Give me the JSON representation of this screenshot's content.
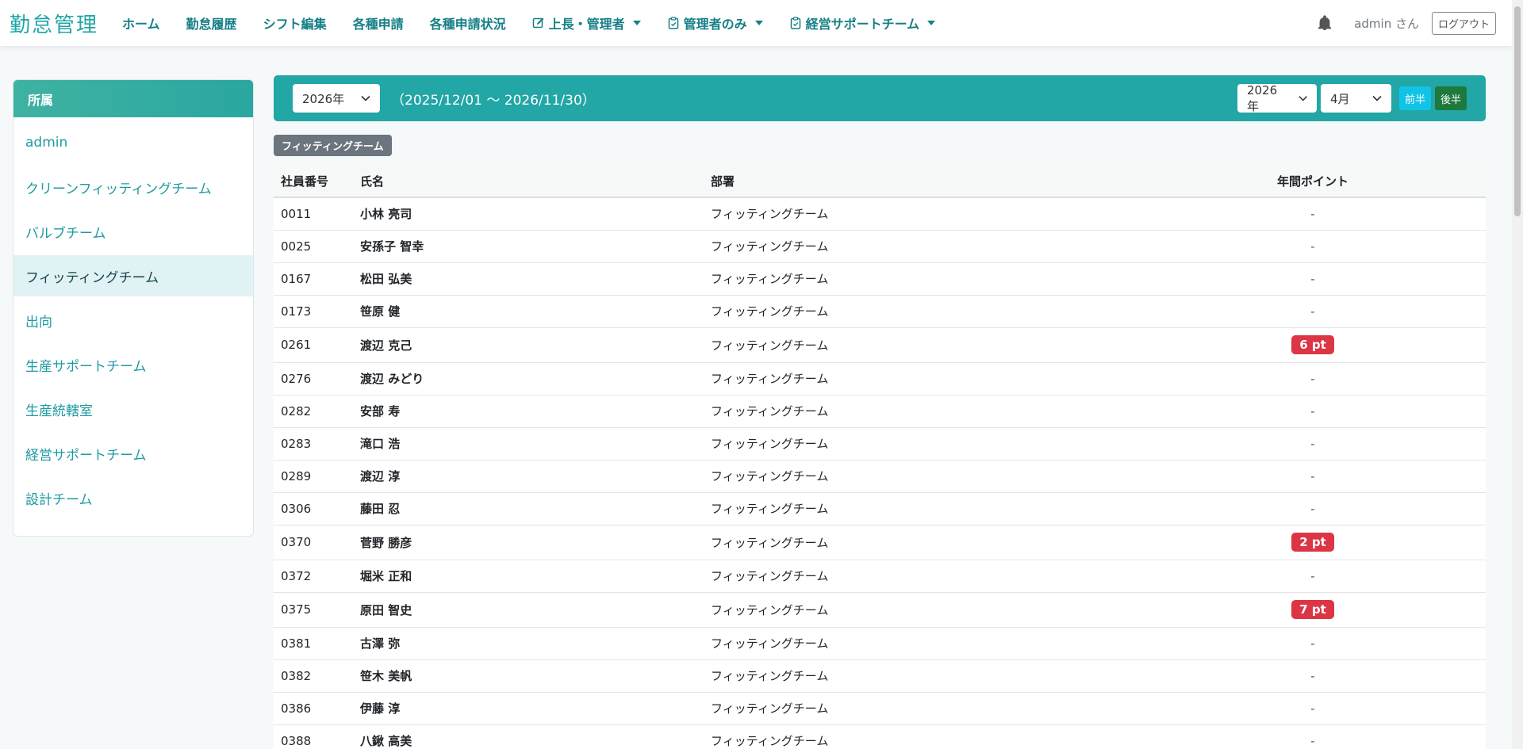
{
  "navbar": {
    "brand": "勤怠管理",
    "items": [
      {
        "label": "ホーム"
      },
      {
        "label": "勤怠履歴"
      },
      {
        "label": "シフト編集"
      },
      {
        "label": "各種申請"
      },
      {
        "label": "各種申請状況"
      },
      {
        "label": "上長・管理者",
        "icon": "edit-icon"
      },
      {
        "label": "管理者のみ",
        "icon": "clipboard-icon"
      },
      {
        "label": "経営サポートチーム",
        "icon": "clipboard-icon"
      }
    ],
    "user": "admin さん",
    "logout": "ログアウト"
  },
  "sidebar": {
    "title": "所属",
    "items": [
      {
        "label": "admin"
      },
      {
        "label": "クリーンフィッティングチーム"
      },
      {
        "label": "バルブチーム"
      },
      {
        "label": "フィッティングチーム",
        "active": true
      },
      {
        "label": "出向"
      },
      {
        "label": "生産サポートチーム"
      },
      {
        "label": "生産統轄室"
      },
      {
        "label": "経営サポートチーム"
      },
      {
        "label": "設計チーム"
      }
    ]
  },
  "filter": {
    "fiscal_year": "2026年",
    "range": "（2025/12/01 〜 2026/11/30）",
    "year": "2026年",
    "month": "4月",
    "first_half": "前半",
    "second_half": "後半"
  },
  "team_badge": "フィッティングチーム",
  "table": {
    "headers": {
      "id": "社員番号",
      "name": "氏名",
      "dept": "部署",
      "points": "年間ポイント"
    },
    "rows": [
      {
        "id": "0011",
        "name": "小林 亮司",
        "dept": "フィッティングチーム",
        "points": "-"
      },
      {
        "id": "0025",
        "name": "安孫子 智幸",
        "dept": "フィッティングチーム",
        "points": "-"
      },
      {
        "id": "0167",
        "name": "松田 弘美",
        "dept": "フィッティングチーム",
        "points": "-"
      },
      {
        "id": "0173",
        "name": "笹原 健",
        "dept": "フィッティングチーム",
        "points": "-"
      },
      {
        "id": "0261",
        "name": "渡辺 克己",
        "dept": "フィッティングチーム",
        "points": "6 pt",
        "highlight": true
      },
      {
        "id": "0276",
        "name": "渡辺 みどり",
        "dept": "フィッティングチーム",
        "points": "-"
      },
      {
        "id": "0282",
        "name": "安部 寿",
        "dept": "フィッティングチーム",
        "points": "-"
      },
      {
        "id": "0283",
        "name": "滝口 浩",
        "dept": "フィッティングチーム",
        "points": "-"
      },
      {
        "id": "0289",
        "name": "渡辺 淳",
        "dept": "フィッティングチーム",
        "points": "-"
      },
      {
        "id": "0306",
        "name": "藤田 忍",
        "dept": "フィッティングチーム",
        "points": "-"
      },
      {
        "id": "0370",
        "name": "菅野 勝彦",
        "dept": "フィッティングチーム",
        "points": "2 pt",
        "highlight": true
      },
      {
        "id": "0372",
        "name": "堀米 正和",
        "dept": "フィッティングチーム",
        "points": "-"
      },
      {
        "id": "0375",
        "name": "原田 智史",
        "dept": "フィッティングチーム",
        "points": "7 pt",
        "highlight": true
      },
      {
        "id": "0381",
        "name": "古澤 弥",
        "dept": "フィッティングチーム",
        "points": "-"
      },
      {
        "id": "0382",
        "name": "笹木 美帆",
        "dept": "フィッティングチーム",
        "points": "-"
      },
      {
        "id": "0386",
        "name": "伊藤 淳",
        "dept": "フィッティングチーム",
        "points": "-"
      },
      {
        "id": "0388",
        "name": "八鍬 高美",
        "dept": "フィッティングチーム",
        "points": "-"
      }
    ]
  }
}
